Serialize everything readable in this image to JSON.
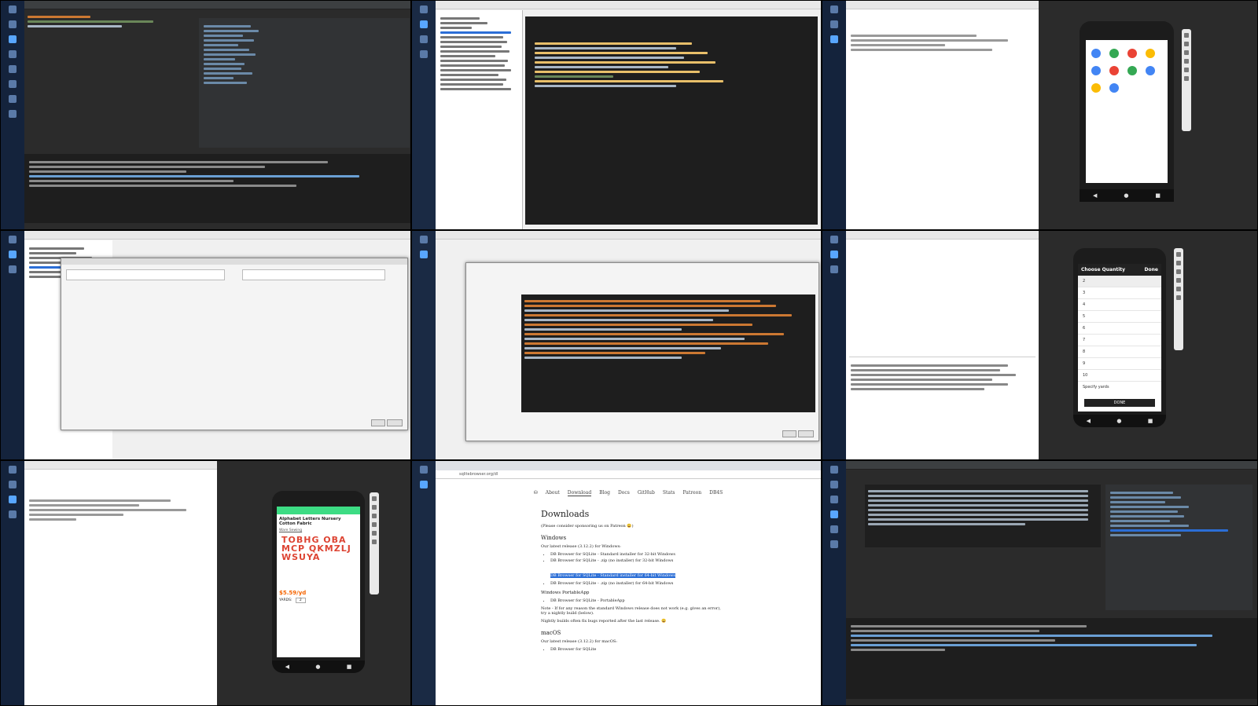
{
  "browser": {
    "url": "sqlitebrowser.org/dl",
    "nav": [
      "About",
      "Download",
      "Blog",
      "Docs",
      "GitHub",
      "Stats",
      "Patreon",
      "DB4S"
    ],
    "active_nav": 1,
    "heading": "Downloads",
    "sponsor_note": "(Please consider sponsoring us on Patreon 😄)",
    "windows_heading": "Windows",
    "windows_intro": "Our latest release (3.12.2) for Windows:",
    "windows_items": [
      "DB Browser for SQLite - Standard installer for 32-bit Windows",
      "DB Browser for SQLite - .zip (no installer) for 32-bit Windows",
      "DB Browser for SQLite - Standard installer for 64-bit Windows",
      "DB Browser for SQLite - .zip (no installer) for 64-bit Windows"
    ],
    "selected_item": 2,
    "portable_heading": "Windows PortableApp",
    "portable_items": [
      "DB Browser for SQLite - PortableApp"
    ],
    "note": "Note - If for any reason the standard Windows release does not work (e.g. gives an error), try a nightly build (below).",
    "nightly": "Nightly builds often fix bugs reported after the last release. 😄",
    "macos_heading": "macOS",
    "macos_intro": "Our latest release (3.12.2) for macOS:",
    "macos_items": [
      "DB Browser for SQLite"
    ]
  },
  "phone_product": {
    "title": "Alphabet Letters Nursery Cotton Fabric",
    "shop": "Ware Sewing",
    "letters": "TOBHG OBAMCP QKMZLJ WSUYA",
    "price": "$5.59/yd",
    "quantity_label": "YARDS:",
    "quantity_value": "2"
  },
  "phone_quantity": {
    "title": "Choose Quantity",
    "done_header": "Done",
    "options": [
      "2",
      "3",
      "4",
      "5",
      "6",
      "7",
      "8",
      "9",
      "10"
    ],
    "custom_label": "Specify yards",
    "done_button": "DONE"
  },
  "colors": {
    "ide_dark": "#2b2b2b",
    "ide_light": "#f0f0f0",
    "accent": "#2b6ed6",
    "etsy_orange": "#f56400",
    "android_green": "#3ddc84"
  }
}
